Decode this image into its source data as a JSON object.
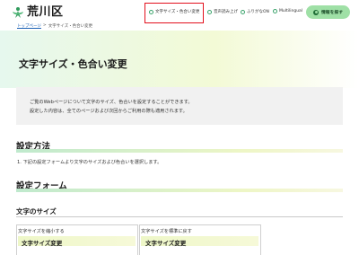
{
  "header": {
    "site_name": "荒川区",
    "links": {
      "font_color": "文字サイズ・色合い変更",
      "voice": "音声読み上げ",
      "ruby": "ふりがなON",
      "language": "Multilingual"
    },
    "search_label": "情報を探す"
  },
  "breadcrumb": {
    "home": "トップページ",
    "separator": ">",
    "current": "文字サイズ・色合い変更"
  },
  "page": {
    "title": "文字サイズ・色合い変更",
    "intro_line1": "ご覧のWebページについて文字のサイズ、色合いを設定することができます。",
    "intro_line2": "設定した内容は、全てのページおよび次回からご利用の際も適用されます。"
  },
  "method": {
    "heading": "設定方法",
    "step1": "1. 下記の設定フォームより文字のサイズおよび色合いを選択します。"
  },
  "form": {
    "heading": "設定フォーム",
    "font_size_heading": "文字のサイズ",
    "shrink_caption": "文字サイズを縮小する",
    "shrink_sample": "文字サイズ変更",
    "reset_caption": "文字サイズを標準に戻す",
    "reset_sample": "文字サイズ変更"
  },
  "colors": {
    "brand_green": "#3aa36b",
    "search_button_bg": "#9fe0a6",
    "highlight_border": "#e3101d"
  },
  "icons": {
    "logo": "arakawa-logo-icon",
    "link_bullet": "circle-bullet-icon",
    "search": "search-icon"
  }
}
